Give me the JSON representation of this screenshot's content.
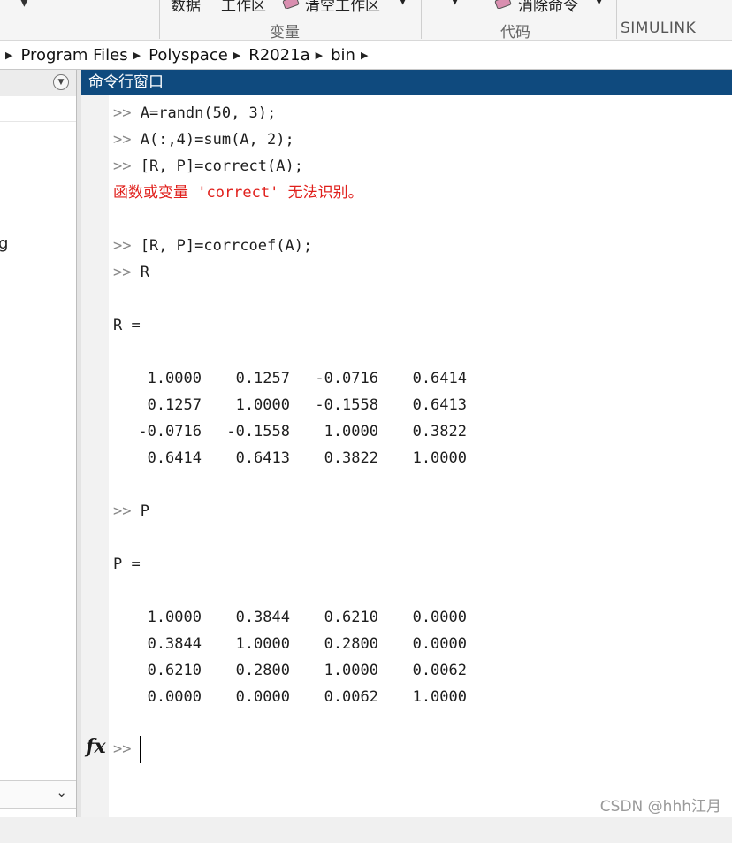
{
  "ribbon": {
    "group1_item1": "数据",
    "group1_item2": "工作区",
    "group1_item3": "清空工作区",
    "group1_label": "变量",
    "group2_item1": "消除命令",
    "group2_label": "代码",
    "tab_label": "SIMULINK"
  },
  "address": {
    "segments": [
      "Program Files",
      "Polyspace",
      "R2021a",
      "bin"
    ]
  },
  "left_panel": {
    "truncated_text": "g"
  },
  "command_window": {
    "title": "命令行窗口",
    "prompt": ">>",
    "lines": [
      {
        "prompt": ">>",
        "text": "A=randn(50, 3);"
      },
      {
        "prompt": ">>",
        "text": "A(:,4)=sum(A, 2);"
      },
      {
        "prompt": ">>",
        "text": "[R, P]=correct(A);"
      },
      {
        "error": "函数或变量 'correct' 无法识别。"
      },
      {
        "prompt": ">>",
        "text": "[R, P]=corrcoef(A);"
      },
      {
        "prompt": ">>",
        "text": "R"
      },
      {
        "text": "R ="
      },
      {
        "text": "P ="
      },
      {
        "prompt": ">>",
        "text": "P"
      }
    ],
    "R_matrix": [
      [
        "1.0000",
        "0.1257",
        "-0.0716",
        "0.6414"
      ],
      [
        "0.1257",
        "1.0000",
        "-0.1558",
        "0.6413"
      ],
      [
        "-0.0716",
        "-0.1558",
        "1.0000",
        "0.3822"
      ],
      [
        "0.6414",
        "0.6413",
        "0.3822",
        "1.0000"
      ]
    ],
    "P_matrix": [
      [
        "1.0000",
        "0.3844",
        "0.6210",
        "0.0000"
      ],
      [
        "0.3844",
        "1.0000",
        "0.2800",
        "0.0000"
      ],
      [
        "0.6210",
        "0.2800",
        "1.0000",
        "0.0062"
      ],
      [
        "0.0000",
        "0.0000",
        "0.0062",
        "1.0000"
      ]
    ],
    "fx_label": "fx"
  },
  "watermark": "CSDN @hhh江月",
  "colors": {
    "title_bar": "#0f4a7e",
    "error_text": "#e0201c",
    "prompt": "#888888"
  }
}
